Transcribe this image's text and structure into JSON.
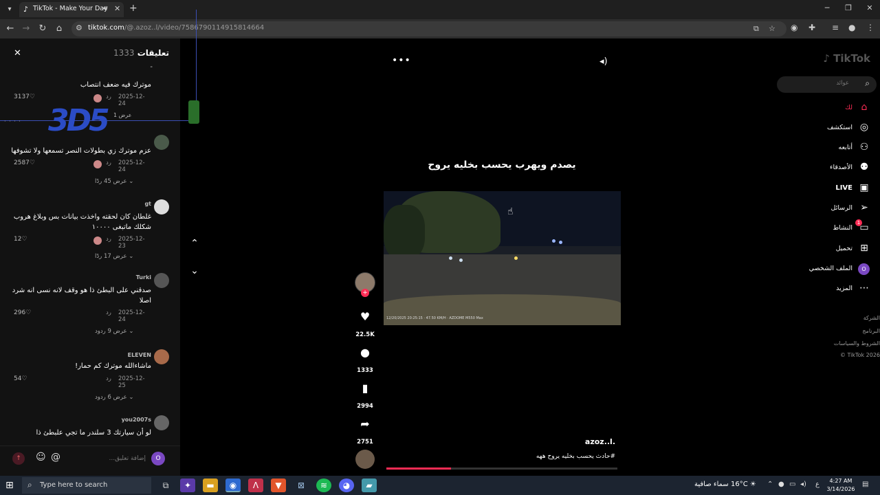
{
  "browser": {
    "tab_title": "TikTok - Make Your Day",
    "url_domain": "tiktok.com",
    "url_path": "/@.azoz..l/video/75867901",
    "url_path_tail": "4915814664",
    "tab_icon": "tiktok-icon",
    "window_buttons": [
      "─",
      "❐",
      "✕"
    ]
  },
  "comments": {
    "title": "تعليقات",
    "count": "1333",
    "dash": "-",
    "items": [
      {
        "user": "",
        "text": "موترك فيه ضعف انتصاب",
        "likes": "3137",
        "date": "2025-12-24",
        "reply": "رد",
        "more": ""
      },
      {
        "user": "",
        "text": "عزم موترك زي بطولات النصر تسمعها ولا تشوفها",
        "likes": "2587",
        "date": "2025-12-24",
        "reply": "رد",
        "more": "عرض 45 ردًا"
      },
      {
        "user": "gt",
        "text": "غلطان كان لحقته واخذت بيانات بس وبلاغ هروب شكلك ماتبغى ١٠٠٠٠",
        "likes": "12",
        "date": "2025-12-23",
        "reply": "رد",
        "more": "عرض 17 ردًا"
      },
      {
        "user": "Turki",
        "text": "صدقني على البطئ ذا هو وقف لانه نسى انه شرد اصلا",
        "likes": "296",
        "date": "2025-12-24",
        "reply": "رد",
        "more": "عرض 9 ردود"
      },
      {
        "user": "ELEVEN",
        "text": "ماشاءالله موترك كم حمار!",
        "likes": "54",
        "date": "2025-12-25",
        "reply": "رد",
        "more": "عرض 6 ردود"
      },
      {
        "user": "you2007s",
        "text": "لو أن سيارتك 3 سلندر ما تجي علبطئ ذا",
        "likes": "",
        "date": "",
        "reply": "",
        "more": ""
      }
    ],
    "input_placeholder": "إضافة تعليق...",
    "me_initial": "O",
    "overlay_show": "عرض 1"
  },
  "video": {
    "caption": "يصدم ويهرب يحسب بخليه يروح",
    "author": "azoz..l.",
    "description": "#حادث يحسب بخليه يروح ههه",
    "progress": 0.28,
    "timestamp_overlay": "12/20/2025 20:25:15 · 47.50 KM/H · AZDOME M550 Max",
    "likes": "22.5K",
    "comments": "1333",
    "saves": "2994",
    "shares": "2751"
  },
  "sidebar": {
    "logo": "TikTok",
    "search_placeholder": "عوائد",
    "items": [
      {
        "label": "لك",
        "icon": "home-icon",
        "glyph": "⌂",
        "active": true
      },
      {
        "label": "استكشف",
        "icon": "compass-icon",
        "glyph": "◎",
        "active": false
      },
      {
        "label": "أتابعه",
        "icon": "user-follow-icon",
        "glyph": "⚇",
        "active": false
      },
      {
        "label": "الأصدقاء",
        "icon": "friends-icon",
        "glyph": "⚉",
        "active": false
      },
      {
        "label": "LIVE",
        "icon": "live-icon",
        "glyph": "▣",
        "active": false
      },
      {
        "label": "الرسائل",
        "icon": "messages-icon",
        "glyph": "➢",
        "active": false
      },
      {
        "label": "النشاط",
        "icon": "activity-icon",
        "glyph": "▭",
        "active": false,
        "badge": "1"
      },
      {
        "label": "تحميل",
        "icon": "upload-icon",
        "glyph": "⊞",
        "active": false
      },
      {
        "label": "الملف الشخصي",
        "icon": "profile-icon",
        "glyph": "O",
        "active": false
      },
      {
        "label": "المزيد",
        "icon": "more-icon",
        "glyph": "⋯",
        "active": false
      }
    ],
    "footer": [
      "الشركة",
      "البرنامج",
      "الشروط والسياسات",
      "© TikTok 2026"
    ]
  },
  "taskbar": {
    "search_text": "Type here to search",
    "weather_temp": "16°C",
    "weather_text": "سماء صافية",
    "lang": "ع",
    "time": "4:27 AM",
    "date": "3/14/2026"
  },
  "colors": {
    "accent": "#fe2c55",
    "panel": "#121212",
    "taskbar": "#1c2430"
  }
}
